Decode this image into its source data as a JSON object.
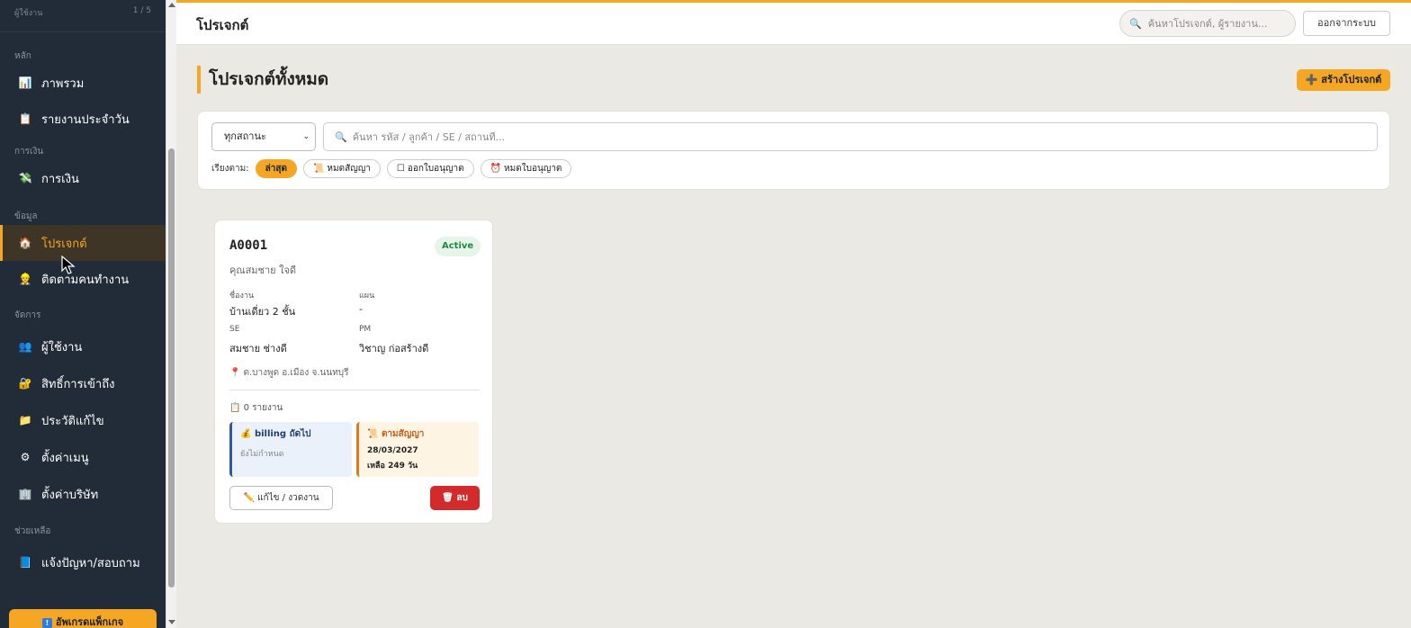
{
  "sidebar": {
    "user_label": "ผู้ใช้งาน",
    "user_count": "1 / 5",
    "sections": {
      "main": "หลัก",
      "finance": "การเงิน",
      "data": "ข้อมูล",
      "manage": "จัดการ",
      "help": "ช่วยเหลือ"
    },
    "items": {
      "overview": "ภาพรวม",
      "daily_report": "รายงานประจำวัน",
      "finance": "การเงิน",
      "projects": "โปรเจกต์",
      "worker_tracking": "ติดตามคนทำงาน",
      "users": "ผู้ใช้งาน",
      "access_rights": "สิทธิ์การเข้าถึง",
      "edit_history": "ประวัติแก้ไข",
      "menu_settings": "ตั้งค่าเมนู",
      "company_settings": "ตั้งค่าบริษัท",
      "report_issue": "แจ้งปัญหา/สอบถาม"
    },
    "active_item": "projects",
    "upgrade_label": "อัพเกรดแพ็กเกจ"
  },
  "topbar": {
    "title": "โปรเจกต์",
    "search_placeholder": "ค้นหาโปรเจกต์, ผู้รายงาน...",
    "logout_label": "ออกจากระบบ"
  },
  "main": {
    "heading": "โปรเจกต์ทั้งหมด",
    "create_label": "สร้างโปรเจกต์",
    "filters": {
      "status_selected": "ทุกสถานะ",
      "search_placeholder": "ค้นหา รหัส / ลูกค้า / SE / สถานที่...",
      "sort_label": "เรียงตาม:",
      "sort_options": {
        "latest": "ล่าสุด",
        "contract_end": "หมดสัญญา",
        "permit_issue": "ออกใบอนุญาต",
        "permit_expire": "หมดใบอนุญาต"
      },
      "active_sort": "latest"
    }
  },
  "projects": [
    {
      "code": "A0001",
      "status": "Active",
      "client": "คุณสมชาย ใจดี",
      "job_name_label": "ชื่องาน",
      "job_name": "บ้านเดี่ยว 2 ชั้น",
      "plan_label": "แผน",
      "plan": "-",
      "se_label": "SE",
      "se": "สมชาย ช่างดี",
      "pm_label": "PM",
      "pm": "วิชาญ ก่อสร้างดี",
      "location": "ต.บางพูด อ.เมือง จ.นนทบุรี",
      "reports": "0 รายงาน",
      "billing_title": "billing ถัดไป",
      "billing_value": "ยังไม่กำหนด",
      "contract_title": "ตามสัญญา",
      "contract_date": "28/03/2027",
      "contract_remaining": "เหลือ 249 วัน",
      "edit_label": "แก้ไข / งวดงาน",
      "delete_label": "ลบ"
    }
  ],
  "colors": {
    "accent": "#f5a623",
    "sidebar_bg": "#222b38",
    "danger": "#d32b2b",
    "status_active": "#1f8a3f"
  }
}
